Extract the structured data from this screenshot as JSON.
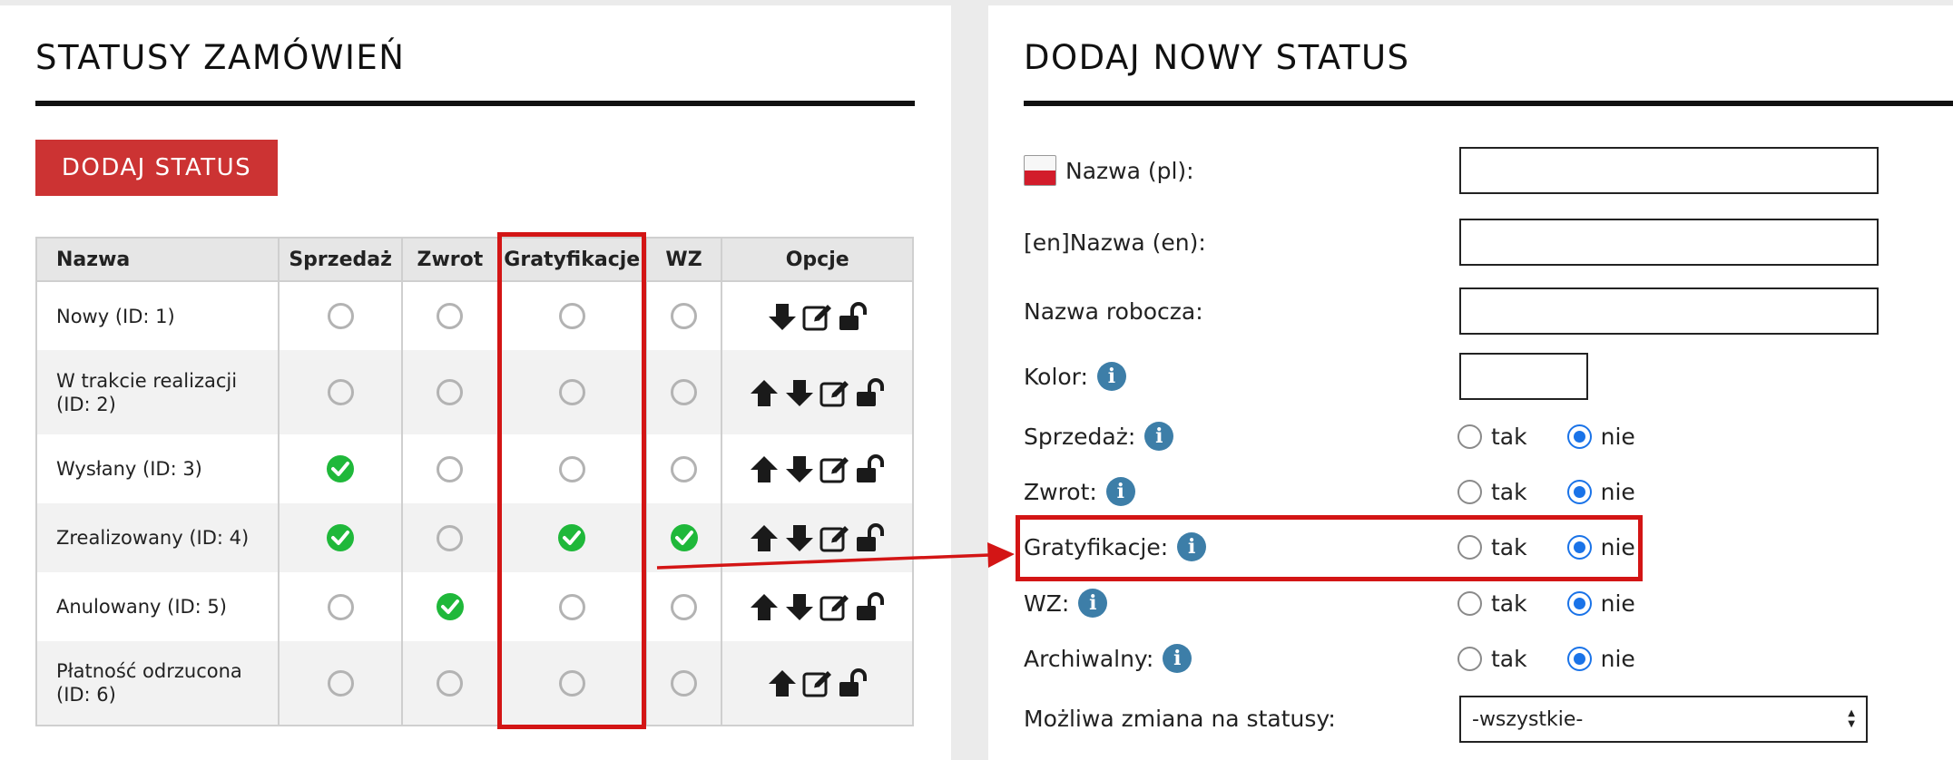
{
  "left": {
    "title": "STATUSY ZAMÓWIEŃ",
    "add_button": "DODAJ STATUS",
    "table": {
      "headers": {
        "name": "Nazwa",
        "sale": "Sprzedaż",
        "return": "Zwrot",
        "gratification": "Gratyfikacje",
        "wz": "WZ",
        "options": "Opcje"
      },
      "rows": [
        {
          "line1": "Nowy (ID: 1)",
          "line2": "",
          "sale": false,
          "return": false,
          "gratification": false,
          "wz": false,
          "up": false,
          "down": true
        },
        {
          "line1": "W trakcie realizacji",
          "line2": "(ID: 2)",
          "sale": false,
          "return": false,
          "gratification": false,
          "wz": false,
          "up": true,
          "down": true
        },
        {
          "line1": "Wysłany (ID: 3)",
          "line2": "",
          "sale": true,
          "return": false,
          "gratification": false,
          "wz": false,
          "up": true,
          "down": true
        },
        {
          "line1": "Zrealizowany (ID: 4)",
          "line2": "",
          "sale": true,
          "return": false,
          "gratification": true,
          "wz": true,
          "up": true,
          "down": true
        },
        {
          "line1": "Anulowany (ID: 5)",
          "line2": "",
          "sale": false,
          "return": true,
          "gratification": false,
          "wz": false,
          "up": true,
          "down": true
        },
        {
          "line1": "Płatność odrzucona",
          "line2": "(ID: 6)",
          "sale": false,
          "return": false,
          "gratification": false,
          "wz": false,
          "up": true,
          "down": false
        }
      ]
    }
  },
  "right": {
    "title": "DODAJ NOWY STATUS",
    "fields": {
      "name_pl": "Nazwa (pl):",
      "en_prefix": "[en]",
      "name_en": "Nazwa (en):",
      "working_name": "Nazwa robocza:",
      "color": "Kolor:",
      "sale": "Sprzedaż:",
      "return": "Zwrot:",
      "gratification": "Gratyfikacje:",
      "wz": "WZ:",
      "archived": "Archiwalny:",
      "allowed_change": "Możliwa zmiana na statusy:"
    },
    "radio": {
      "yes": "tak",
      "no": "nie"
    },
    "select_value": "-wszystkie-",
    "info_glyph": "i"
  },
  "colors": {
    "accent_red": "#cc3333",
    "highlight_red": "#d31515",
    "check_green": "#1fb83a",
    "info_blue": "#3d7ea8",
    "radio_blue": "#1a73e8"
  },
  "icons": {
    "up": "arrow-up-icon",
    "down": "arrow-down-icon",
    "edit": "edit-icon",
    "lock": "unlock-icon",
    "check": "check-circle-icon",
    "info": "info-icon",
    "flag": "flag-pl-icon"
  }
}
